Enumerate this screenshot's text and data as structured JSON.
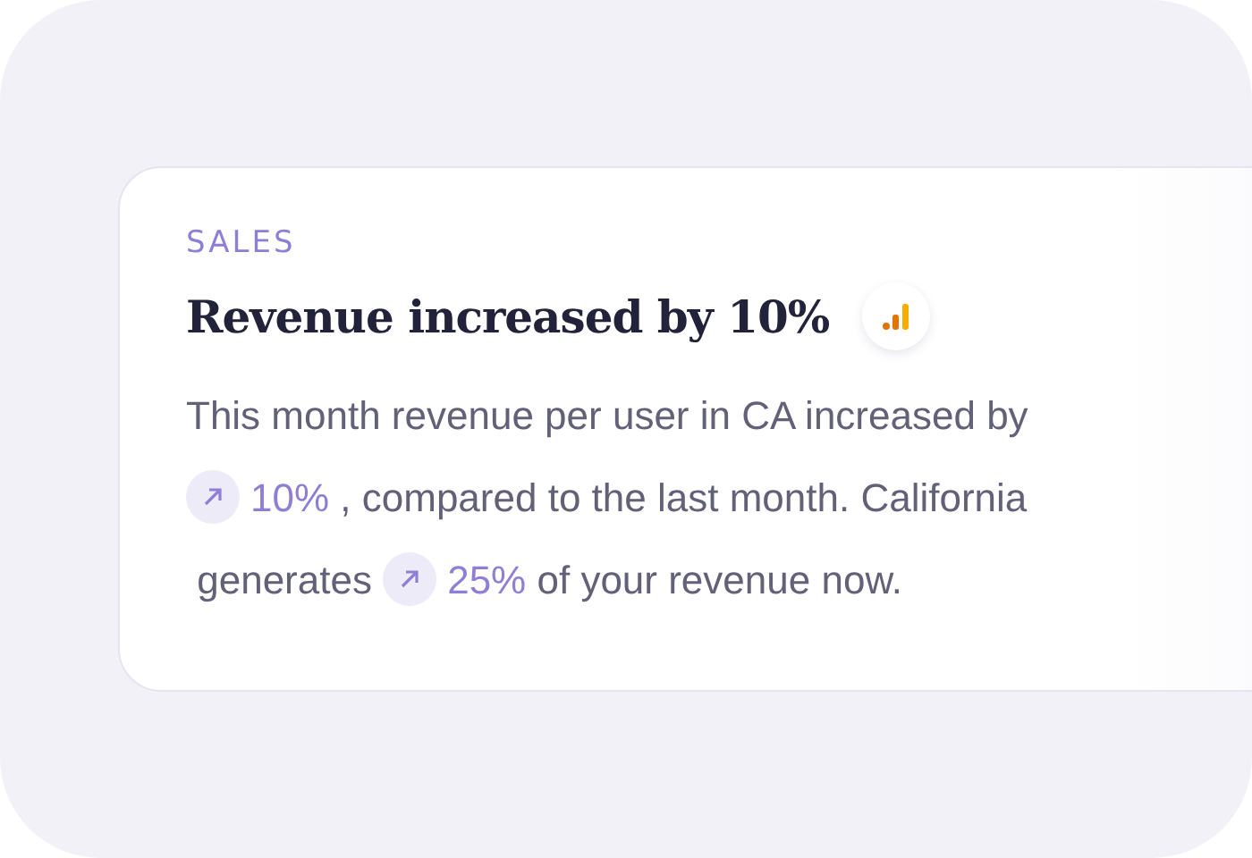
{
  "card": {
    "category": "SALES",
    "title": "Revenue increased by 10%",
    "body": [
      [
        {
          "kind": "text",
          "text": "This month revenue per user in CA increased by"
        }
      ],
      [
        {
          "kind": "trend",
          "text": "10%"
        },
        {
          "kind": "text",
          "text": " , compared to the last month. California"
        }
      ],
      [
        {
          "kind": "text",
          "text": " generates "
        },
        {
          "kind": "trend",
          "text": "25%"
        },
        {
          "kind": "text",
          "text": " of your revenue now."
        }
      ]
    ]
  }
}
